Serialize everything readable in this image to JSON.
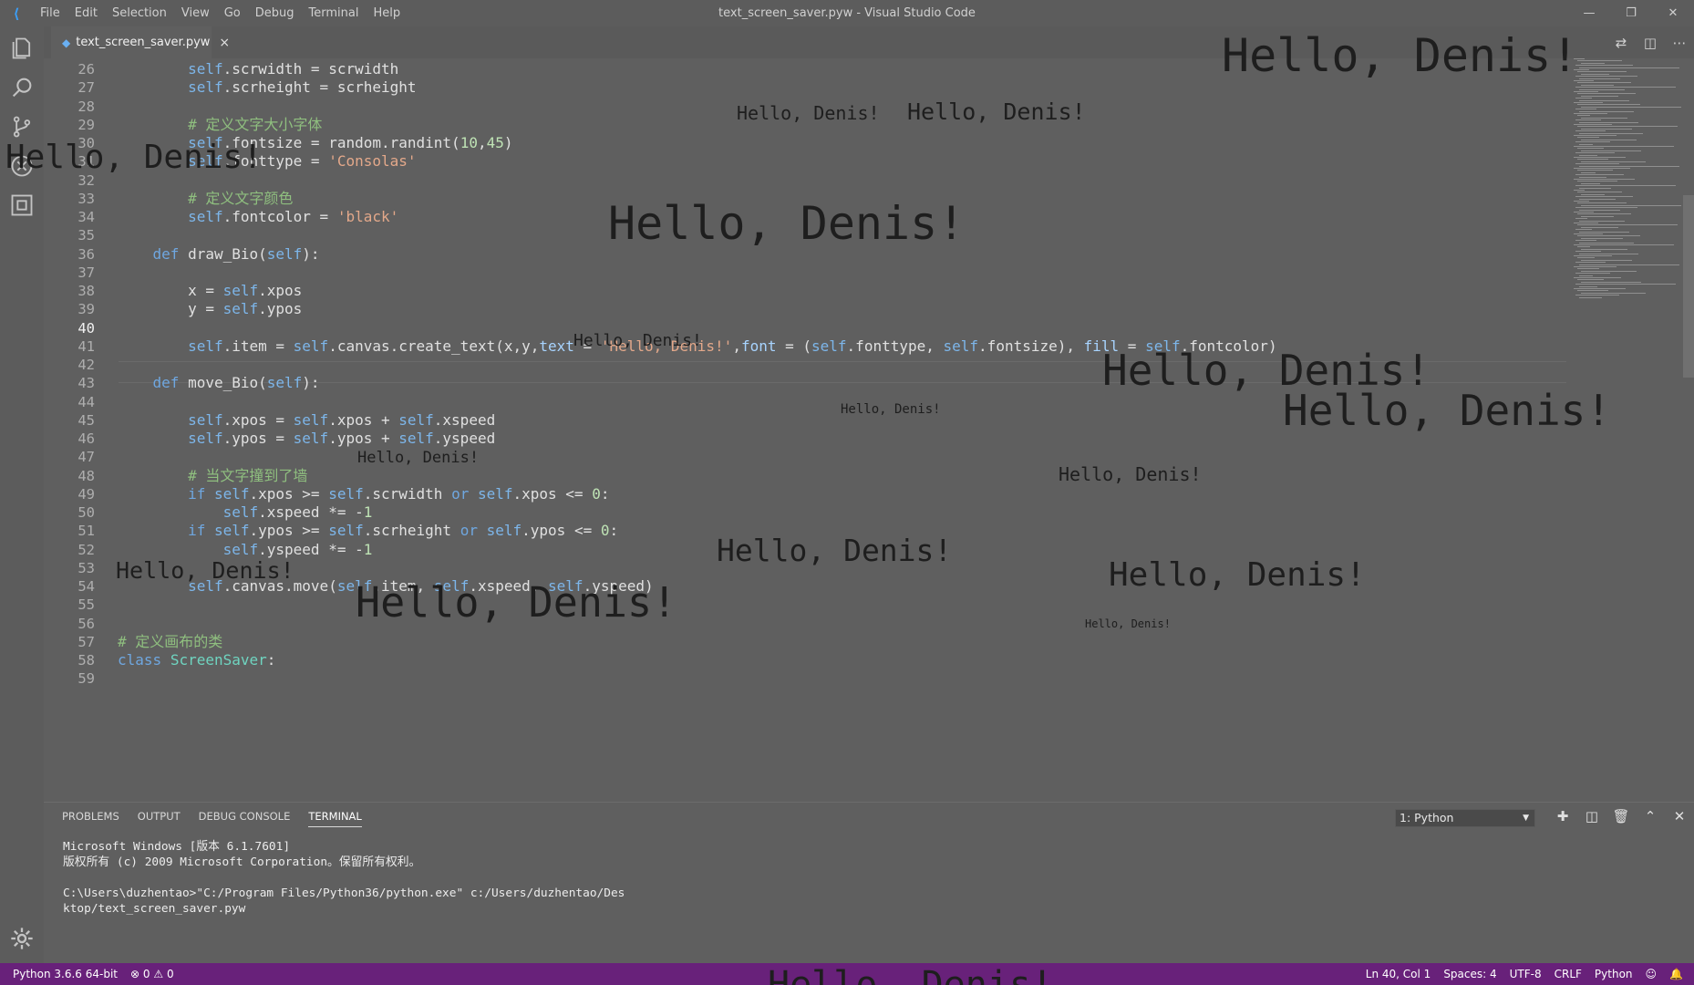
{
  "window": {
    "title": "text_screen_saver.pyw - Visual Studio Code",
    "menu": [
      "File",
      "Edit",
      "Selection",
      "View",
      "Go",
      "Debug",
      "Terminal",
      "Help"
    ]
  },
  "tab": {
    "label": "text_screen_saver.pyw",
    "close": "×"
  },
  "editor": {
    "current_line": "40",
    "lines": [
      {
        "n": "26",
        "code": "        self.scrwidth = scrwidth"
      },
      {
        "n": "27",
        "code": "        self.scrheight = scrheight"
      },
      {
        "n": "28",
        "code": ""
      },
      {
        "n": "29",
        "code": "        # 定义文字大小字体"
      },
      {
        "n": "30",
        "code": "        self.fontsize = random.randint(10,45)"
      },
      {
        "n": "31",
        "code": "        self.fonttype = 'Consolas'"
      },
      {
        "n": "32",
        "code": ""
      },
      {
        "n": "33",
        "code": "        # 定义文字颜色"
      },
      {
        "n": "34",
        "code": "        self.fontcolor = 'black'"
      },
      {
        "n": "35",
        "code": ""
      },
      {
        "n": "36",
        "code": "    def draw_Bio(self):"
      },
      {
        "n": "37",
        "code": ""
      },
      {
        "n": "38",
        "code": "        x = self.xpos"
      },
      {
        "n": "39",
        "code": "        y = self.ypos"
      },
      {
        "n": "40",
        "code": ""
      },
      {
        "n": "41",
        "code": "        self.item = self.canvas.create_text(x,y,text = 'Hello, Denis!',font = (self.fonttype, self.fontsize), fill = self.fontcolor)"
      },
      {
        "n": "42",
        "code": ""
      },
      {
        "n": "43",
        "code": "    def move_Bio(self):"
      },
      {
        "n": "44",
        "code": ""
      },
      {
        "n": "45",
        "code": "        self.xpos = self.xpos + self.xspeed"
      },
      {
        "n": "46",
        "code": "        self.ypos = self.ypos + self.yspeed"
      },
      {
        "n": "47",
        "code": ""
      },
      {
        "n": "48",
        "code": "        # 当文字撞到了墙"
      },
      {
        "n": "49",
        "code": "        if self.xpos >= self.scrwidth or self.xpos <= 0:"
      },
      {
        "n": "50",
        "code": "            self.xspeed *= -1"
      },
      {
        "n": "51",
        "code": "        if self.ypos >= self.scrheight or self.ypos <= 0:"
      },
      {
        "n": "52",
        "code": "            self.yspeed *= -1"
      },
      {
        "n": "53",
        "code": ""
      },
      {
        "n": "54",
        "code": "        self.canvas.move(self.item, self.xspeed, self.yspeed)"
      },
      {
        "n": "55",
        "code": ""
      },
      {
        "n": "56",
        "code": ""
      },
      {
        "n": "57",
        "code": "# 定义画布的类"
      },
      {
        "n": "58",
        "code": "class ScreenSaver:"
      },
      {
        "n": "59",
        "code": ""
      }
    ]
  },
  "overlay_text": "Hello, Denis!",
  "panel": {
    "tabs": [
      "PROBLEMS",
      "OUTPUT",
      "DEBUG CONSOLE",
      "TERMINAL"
    ],
    "active_tab": "TERMINAL",
    "terminal_select": "1: Python",
    "terminal_lines": [
      "Microsoft Windows [版本 6.1.7601]",
      "版权所有 (c) 2009 Microsoft Corporation。保留所有权利。",
      "",
      "C:\\Users\\duzhentao>\"C:/Program Files/Python36/python.exe\" c:/Users/duzhentao/Des",
      "ktop/text_screen_saver.pyw"
    ]
  },
  "status": {
    "python": "Python 3.6.6 64-bit",
    "errors": "0",
    "warnings": "0",
    "position": "Ln 40, Col 1",
    "spaces": "Spaces: 4",
    "encoding": "UTF-8",
    "eol": "CRLF",
    "language": "Python"
  },
  "colors": {
    "statusbar": "#68217a",
    "background": "#5f5f5f",
    "hello_text": "#1e1e1e"
  },
  "icons": [
    "explorer-icon",
    "search-icon",
    "source-control-icon",
    "debug-icon",
    "extensions-icon",
    "settings-gear-icon"
  ]
}
